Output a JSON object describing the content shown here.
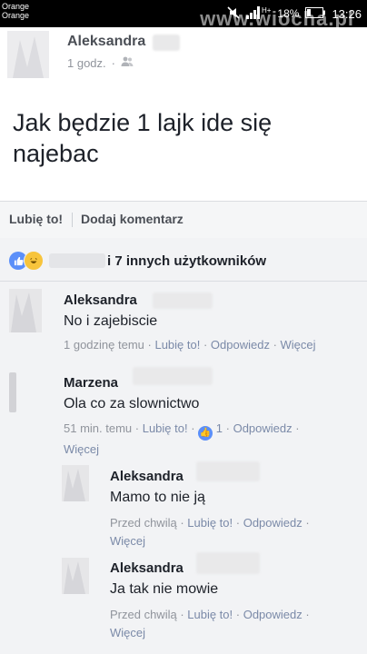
{
  "status_bar": {
    "carrier_line1": "Orange",
    "carrier_line2": "Orange",
    "network": "H+",
    "battery": "18%",
    "time": "13:26",
    "watermark": "www.wiocha.pl"
  },
  "post": {
    "author": "Aleksandra",
    "time": "1 godz.",
    "privacy_icon": "friends-icon",
    "text": "Jak będzie 1 lajk ide się najebac"
  },
  "actions": {
    "like": "Lubię to!",
    "comment": "Dodaj komentarz"
  },
  "reactions": {
    "text": "i 7 innych użytkowników"
  },
  "comments": [
    {
      "author": "Aleksandra",
      "text": "No i zajebiscie",
      "time": "1 godzinę temu",
      "like": "Lubię to!",
      "reply": "Odpowiedz",
      "more": "Więcej"
    },
    {
      "author": "Marzena",
      "text": "Ola co za slownictwo",
      "time": "51 min. temu",
      "like": "Lubię to!",
      "likes_count": "1",
      "reply": "Odpowiedz",
      "more": "Więcej"
    },
    {
      "author": "Aleksandra",
      "text": "Mamo to nie ją",
      "time": "Przed chwilą",
      "like": "Lubię to!",
      "reply": "Odpowiedz",
      "more": "Więcej"
    },
    {
      "author": "Aleksandra",
      "text": "Ja tak nie mowie",
      "time": "Przed chwilą",
      "like": "Lubię to!",
      "reply": "Odpowiedz",
      "more": "Więcej"
    }
  ],
  "colors": {
    "link": "#7b8aa8",
    "like_blue": "#5b8ff9",
    "comment_bg": "#f2f3f5"
  }
}
